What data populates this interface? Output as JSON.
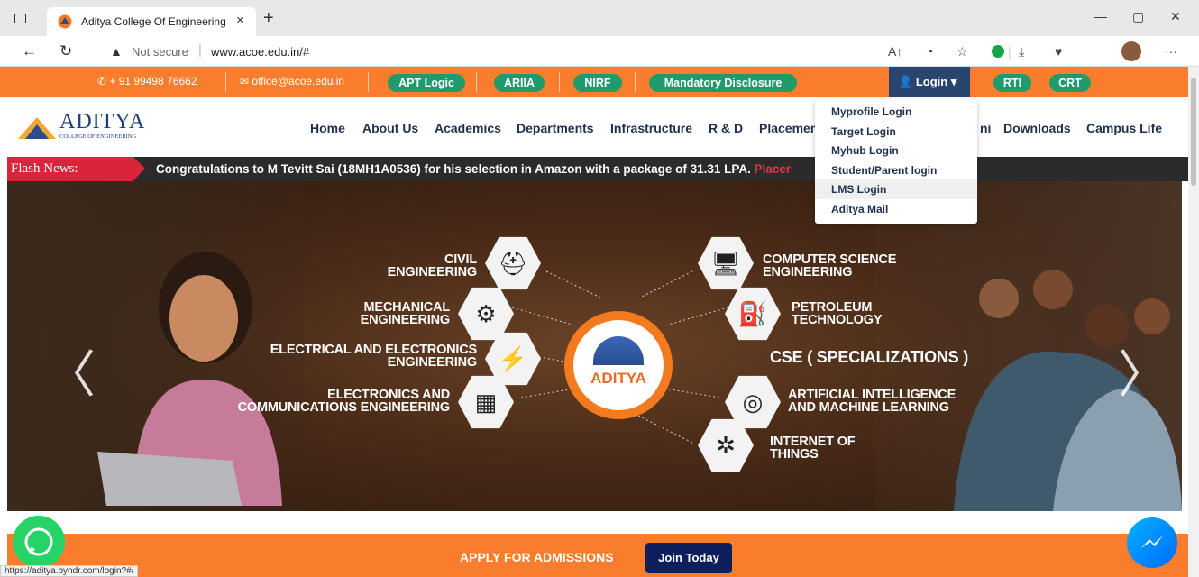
{
  "browser": {
    "tab_title": "Aditya College Of Engineering",
    "tab_close": "×",
    "new_tab": "+",
    "address": {
      "security_label": "Not secure",
      "url": "www.acoe.edu.in/#"
    },
    "status_url": "https://aditya.byndr.com/login?#/"
  },
  "topbar": {
    "phone": "+ 91 99498 76662",
    "email": "office@acoe.edu.in",
    "pills": [
      "APT Logic",
      "ARIIA",
      "NIRF",
      "Mandatory Disclosure"
    ],
    "login_label": "Login",
    "rti": "RTI",
    "crt": "CRT"
  },
  "logo": {
    "name": "ADITYA",
    "subtitle": "COLLEGE OF ENGINEERING"
  },
  "nav": [
    "Home",
    "About Us",
    "Academics",
    "Departments",
    "Infrastructure",
    "R & D",
    "Placemen",
    "ni",
    "Downloads",
    "Campus Life"
  ],
  "login_dropdown": [
    "Myprofile Login",
    "Target Login",
    "Myhub Login",
    "Student/Parent login",
    "LMS Login",
    "Aditya Mail"
  ],
  "flash": {
    "label": "Flash News:",
    "text": "Congratulations to M Tevitt Sai (18MH1A0536) for his selection in Amazon with a package of 31.31 LPA.",
    "text_tail": "Placer"
  },
  "banner": {
    "center": "ADITYA",
    "left": [
      {
        "line1": "CIVIL",
        "line2": "ENGINEERING"
      },
      {
        "line1": "MECHANICAL",
        "line2": "ENGINEERING"
      },
      {
        "line1": "ELECTRICAL AND ELECTRONICS",
        "line2": "ENGINEERING"
      },
      {
        "line1": "ELECTRONICS AND",
        "line2": "COMMUNICATIONS ENGINEERING"
      }
    ],
    "right": [
      {
        "line1": "COMPUTER SCIENCE",
        "line2": "ENGINEERING"
      },
      {
        "line1": "PETROLEUM",
        "line2": "TECHNOLOGY"
      },
      {
        "line1": "CSE ( SPECIALIZATIONS )",
        "line2": ""
      },
      {
        "line1": "ARTIFICIAL INTELLIGENCE",
        "line2": "AND MACHINE LEARNING"
      },
      {
        "line1": "INTERNET OF",
        "line2": "THINGS"
      }
    ],
    "prev_arrow": "〈",
    "next_arrow": "〉"
  },
  "bottom": {
    "apply": "APPLY FOR ADMISSIONS",
    "join": "Join Today"
  },
  "colors": {
    "orange": "#f97d2d",
    "green_pill": "#1f9a6a",
    "login_bg": "#27456e",
    "flash_red": "#d9243b",
    "join_bg": "#0e1f5e"
  }
}
